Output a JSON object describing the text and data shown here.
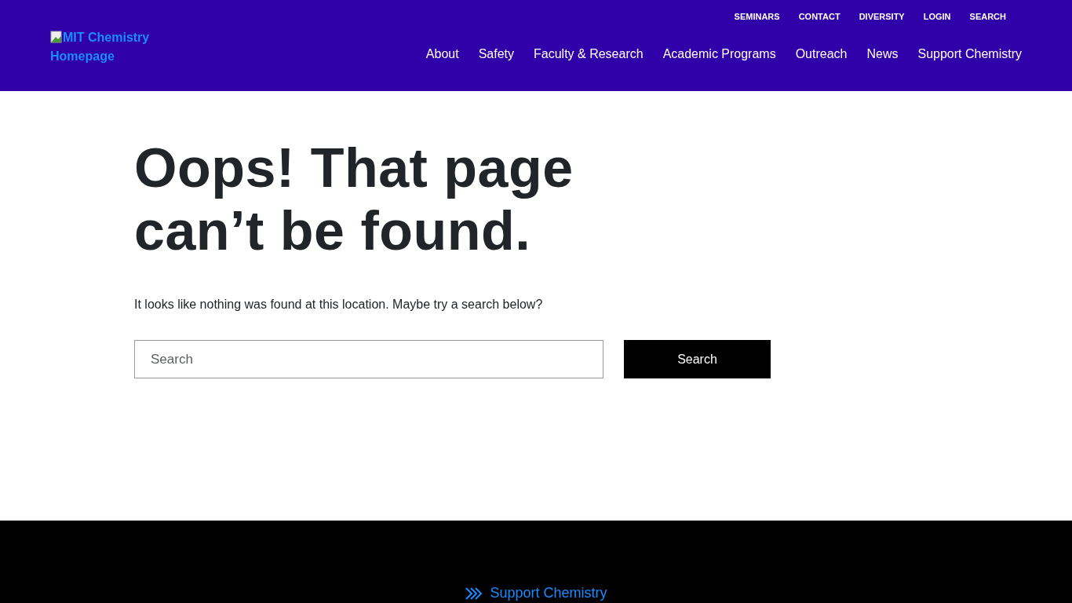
{
  "header": {
    "logo_alt": "MIT Chemistry Homepage",
    "utility_links": [
      "SEMINARS",
      "CONTACT",
      "DIVERSITY",
      "LOGIN",
      "SEARCH"
    ],
    "main_nav": [
      "About",
      "Safety",
      "Faculty & Research",
      "Academic Programs",
      "Outreach",
      "News",
      "Support Chemistry"
    ]
  },
  "main": {
    "heading": "Oops! That page can’t be found.",
    "message": "It looks like nothing was found at this location. Maybe try a search below?",
    "search": {
      "placeholder": "Search",
      "button": "Search"
    }
  },
  "footer": {
    "link": "Support Chemistry"
  }
}
